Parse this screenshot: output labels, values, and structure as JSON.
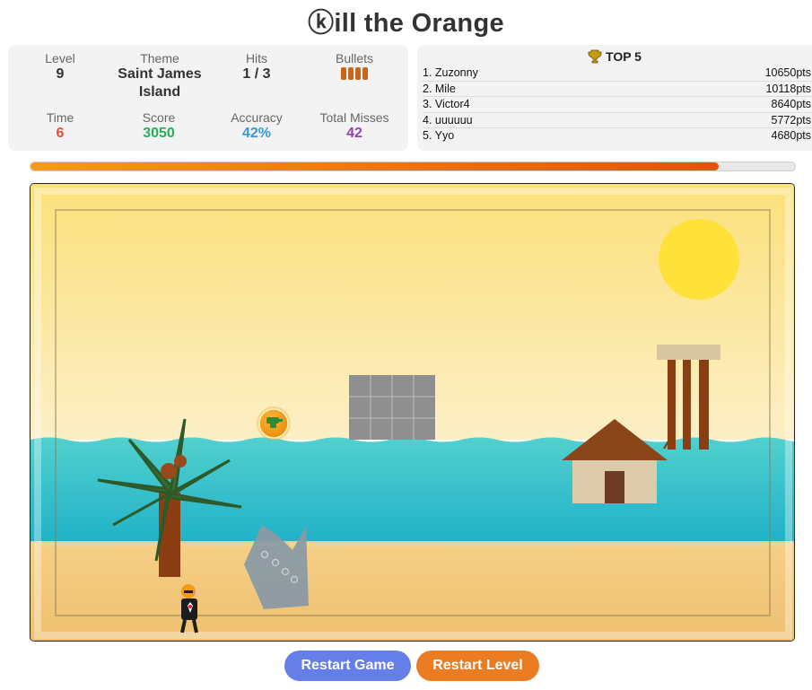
{
  "title": "ⓚill the Orange",
  "stats": {
    "level": {
      "label": "Level",
      "value": "9"
    },
    "theme": {
      "label": "Theme",
      "value": "Saint James Island"
    },
    "hits": {
      "label": "Hits",
      "value": "1 / 3"
    },
    "bullets": {
      "label": "Bullets",
      "count": 4
    },
    "time": {
      "label": "Time",
      "value": "6",
      "color": "#e74c3c"
    },
    "score": {
      "label": "Score",
      "value": "3050",
      "color": "#27ae60"
    },
    "accuracy": {
      "label": "Accuracy",
      "value": "42%",
      "color": "#3498db"
    },
    "misses": {
      "label": "Total Misses",
      "value": "42",
      "color": "#8e44ad"
    }
  },
  "leaderboard": {
    "title": "TOP 5",
    "icon": "trophy-icon",
    "entries": [
      {
        "rank": "1. Zuzonny",
        "score": "10650pts"
      },
      {
        "rank": "2. Mile",
        "score": "10118pts"
      },
      {
        "rank": "3. Victor4",
        "score": "8640pts"
      },
      {
        "rank": "4. uuuuuu",
        "score": "5772pts"
      },
      {
        "rank": "5. Yyo",
        "score": "4680pts"
      }
    ]
  },
  "progress": {
    "fraction": 0.9
  },
  "buttons": {
    "restart_game": "Restart Game",
    "restart_level": "Restart Level"
  },
  "colors": {
    "sky": "#fbe07a",
    "sea": "#2bbbc9",
    "sand": "#f3c878",
    "sun": "#ffe13a",
    "orange_target": "#f39c12",
    "restart_game": "#667ee8",
    "restart_level": "#ea7d24"
  }
}
